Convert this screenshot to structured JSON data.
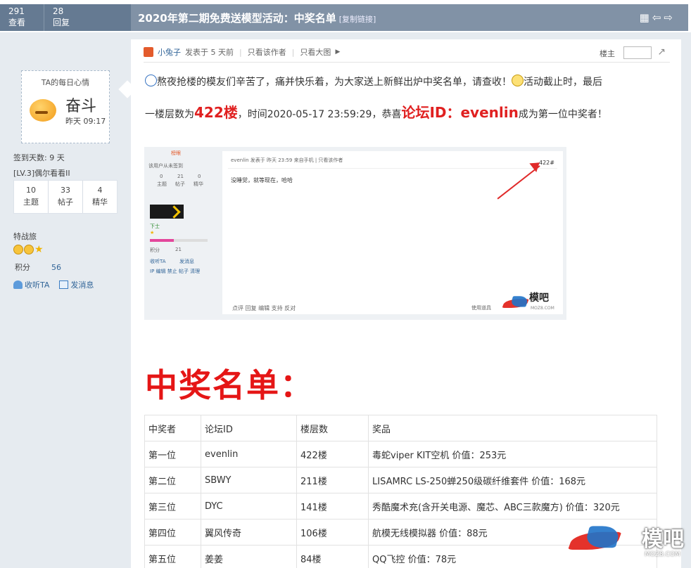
{
  "stats": {
    "views_value": "291",
    "views_label": "查看",
    "replies_value": "28",
    "replies_label": "回复"
  },
  "thread": {
    "title": "2020年第二期免费送模型活动：中奖名单",
    "copy_link": "[复制链接]"
  },
  "sidebar": {
    "mood_title": "TA的每日心情",
    "mood": "奋斗",
    "mood_time": "昨天 09:17",
    "signin": "签到天数: 9 天",
    "level": "[LV.3]偶尔看看II",
    "stats": [
      {
        "value": "10",
        "label": "主题"
      },
      {
        "value": "33",
        "label": "帖子"
      },
      {
        "value": "4",
        "label": "精华"
      }
    ],
    "group": "特战旅",
    "score_label": "积分",
    "score_value": "56",
    "follow": "收听TA",
    "message": "发消息"
  },
  "post": {
    "author": "小兔子",
    "posted": "发表于 5 天前",
    "only_author": "只看该作者",
    "large_image": "只看大图",
    "floor_label": "楼主",
    "line1_a": "熬夜抢楼的模友们辛苦了，痛并快乐着，为大家送上新鲜出炉中奖名单，请查收！",
    "line1_b": "活动截止时，最后",
    "line2_a": "一楼层数为",
    "line2_floor": "422楼",
    "line2_b": "，时间2020-05-17 23:59:29，恭喜",
    "line2_id": "论坛ID：evenlin",
    "line2_c": "成为第一位中奖者！",
    "winners_heading": "中奖名单：",
    "table_header": [
      "中奖者",
      "论坛ID",
      "楼层数",
      "奖品"
    ],
    "table_rows": [
      [
        "第一位",
        "evenlin",
        "422楼",
        "毒蛇viper KIT空机  价值：253元"
      ],
      [
        "第二位",
        "SBWY",
        "211楼",
        "LISAMRC  LS-250蝉250级碳纤维套件  价值：168元"
      ],
      [
        "第三位",
        "DYC",
        "141楼",
        "秀酷魔术充(含开关电源、魔芯、ABC三款魔方)  价值：320元"
      ],
      [
        "第四位",
        "翼风传奇",
        "106楼",
        "航模无线模拟器  价值：88元"
      ],
      [
        "第五位",
        "姜姜",
        "84楼",
        "QQ飞控  价值：78元"
      ]
    ]
  },
  "screenshot": {
    "badge": "榜眼",
    "checkin": "该用户从未签到",
    "stats": [
      {
        "value": "0",
        "label": "主题"
      },
      {
        "value": "21",
        "label": "帖子"
      },
      {
        "value": "0",
        "label": "精华"
      }
    ],
    "rank": "下士",
    "score_label": "积分",
    "score_value": "21",
    "follow": "收听TA",
    "message": "发消息",
    "admin": "IP 编辑 禁止 帖子 清理",
    "post_head": "evenlin 发表于 昨天 23:59 来自手机  |  只看该作者",
    "floor": "422#",
    "content": "没睡觉，就等现在，哈哈",
    "actions": "点评   回复   编辑   支持   反对",
    "tools": "使用道具",
    "logo": "模吧",
    "logo_sub": "MOZ8.COM"
  },
  "watermark": {
    "text": "模吧",
    "sub": "MOZ8.COM"
  }
}
